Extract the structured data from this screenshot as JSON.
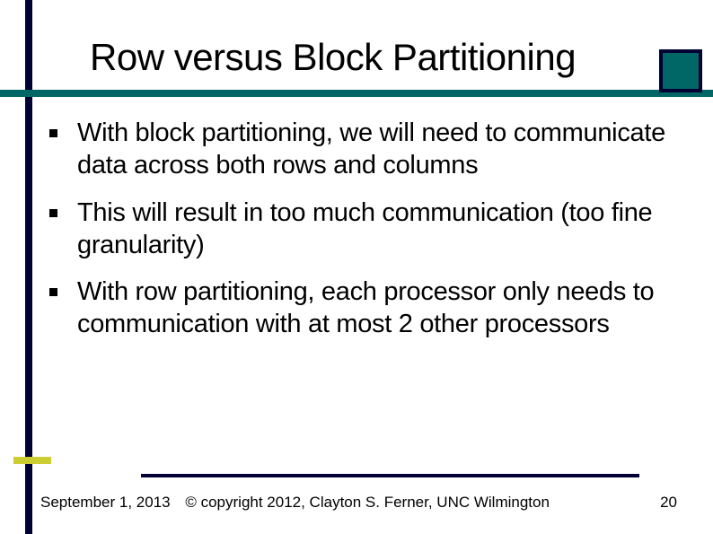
{
  "title": "Row versus Block Partitioning",
  "bullets": [
    "With block partitioning, we will need to communicate data across both rows and columns",
    "This will result in too much communication (too fine granularity)",
    "With row partitioning, each processor only needs to communication with at most 2 other processors"
  ],
  "footer": {
    "date": "September 1, 2013",
    "copyright": "© copyright 2012, Clayton S. Ferner, UNC Wilmington"
  },
  "page_number": "20"
}
